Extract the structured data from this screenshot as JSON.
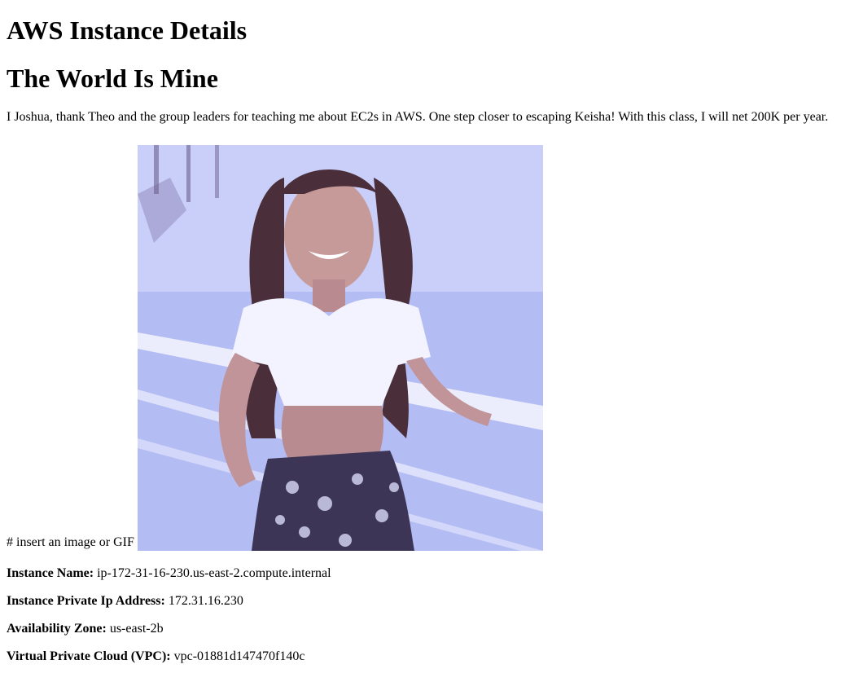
{
  "page": {
    "title": "AWS Instance Details",
    "subtitle": "The World Is Mine",
    "intro": "I Joshua, thank Theo and the group leaders for teaching me about EC2s in AWS. One step closer to escaping Keisha! With this class, I will net 200K per year.",
    "image_caption": "# insert an image or GIF"
  },
  "details": [
    {
      "label": "Instance Name:",
      "value": "ip-172-31-16-230.us-east-2.compute.internal"
    },
    {
      "label": "Instance Private Ip Address:",
      "value": "172.31.16.230"
    },
    {
      "label": "Availability Zone:",
      "value": "us-east-2b"
    },
    {
      "label": "Virtual Private Cloud (VPC):",
      "value": "vpc-01881d147470f140c"
    }
  ]
}
